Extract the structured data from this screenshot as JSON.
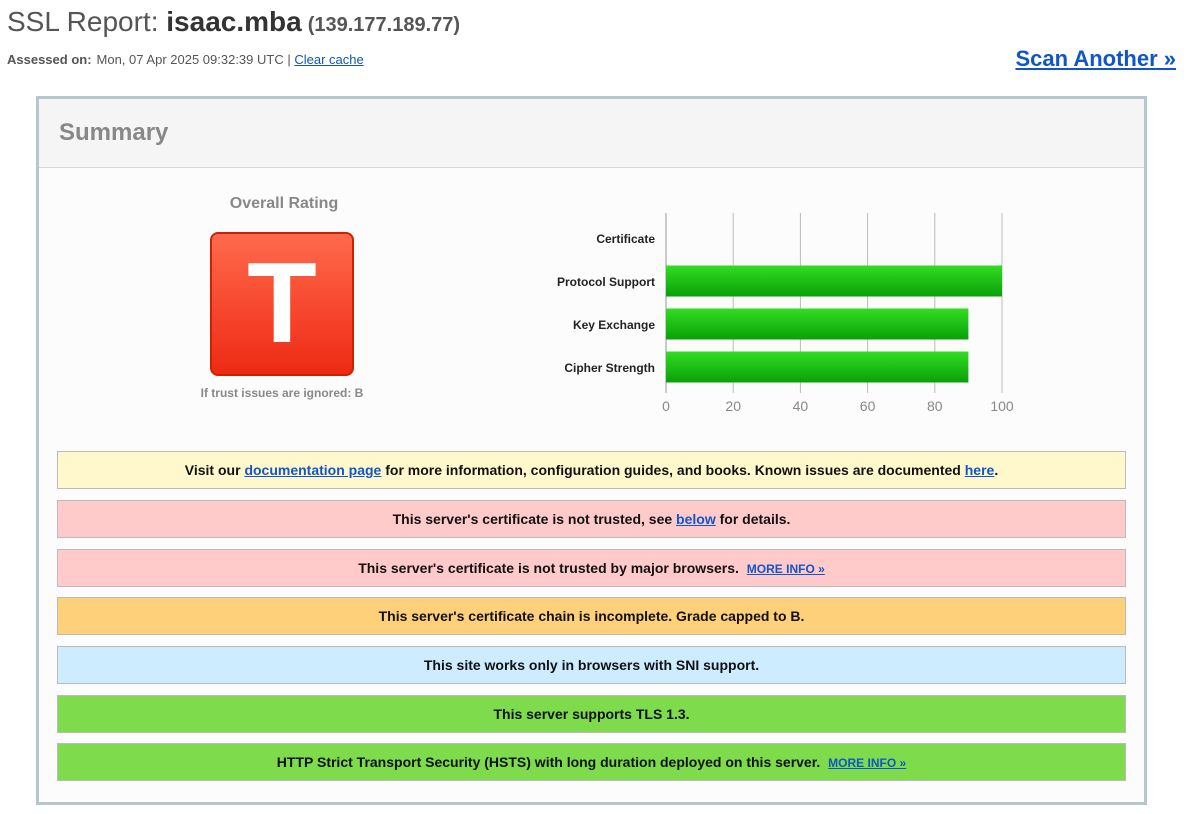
{
  "header": {
    "title_prefix": "SSL Report:",
    "hostname": "isaac.mba",
    "ip": "(139.177.189.77)",
    "assessed_label": "Assessed on:",
    "assessed_value": "Mon, 07 Apr 2025 09:32:39 UTC |",
    "clear_cache": "Clear cache",
    "scan_another": "Scan Another »"
  },
  "summary": {
    "title": "Summary",
    "overall_label": "Overall Rating",
    "grade": "T",
    "grade_colors": {
      "top": "#ff6a4c",
      "bottom": "#ee2a14"
    },
    "trust_note": "If trust issues are ignored: B"
  },
  "chart_data": {
    "type": "bar",
    "orientation": "horizontal",
    "categories": [
      "Certificate",
      "Protocol Support",
      "Key Exchange",
      "Cipher Strength"
    ],
    "values": [
      0,
      100,
      90,
      90
    ],
    "xlim": [
      0,
      100
    ],
    "xticks": [
      0,
      20,
      40,
      60,
      80,
      100
    ],
    "grid": true,
    "bar_color": "#11bb11"
  },
  "notices": [
    {
      "bg": "#fff8cc",
      "parts": [
        {
          "t": "Visit our "
        },
        {
          "t": "documentation page",
          "link": true,
          "name": "documentation-page-link"
        },
        {
          "t": " for more information, configuration guides, and books. Known issues are documented "
        },
        {
          "t": "here",
          "link": true,
          "name": "known-issues-link"
        },
        {
          "t": "."
        }
      ]
    },
    {
      "bg": "#ffcaca",
      "parts": [
        {
          "t": "This server's certificate is not trusted, see "
        },
        {
          "t": "below",
          "link": true,
          "name": "below-link"
        },
        {
          "t": " for details."
        }
      ]
    },
    {
      "bg": "#ffcaca",
      "parts": [
        {
          "t": "This server's certificate is not trusted by major browsers. "
        },
        {
          "t": "MORE INFO »",
          "link": true,
          "more": true,
          "name": "more-info-link"
        }
      ]
    },
    {
      "bg": "#ffd07a",
      "parts": [
        {
          "t": "This server's certificate chain is incomplete. Grade capped to B."
        }
      ]
    },
    {
      "bg": "#cdecff",
      "parts": [
        {
          "t": "This site works only in browsers with SNI support."
        }
      ]
    },
    {
      "bg": "#7ddb4c",
      "parts": [
        {
          "t": "This server supports TLS 1.3."
        }
      ]
    },
    {
      "bg": "#7ddb4c",
      "parts": [
        {
          "t": "HTTP Strict Transport Security (HSTS) with long duration deployed on this server.  "
        },
        {
          "t": "MORE INFO »",
          "link": true,
          "more": true,
          "name": "hsts-more-info-link"
        }
      ]
    }
  ]
}
